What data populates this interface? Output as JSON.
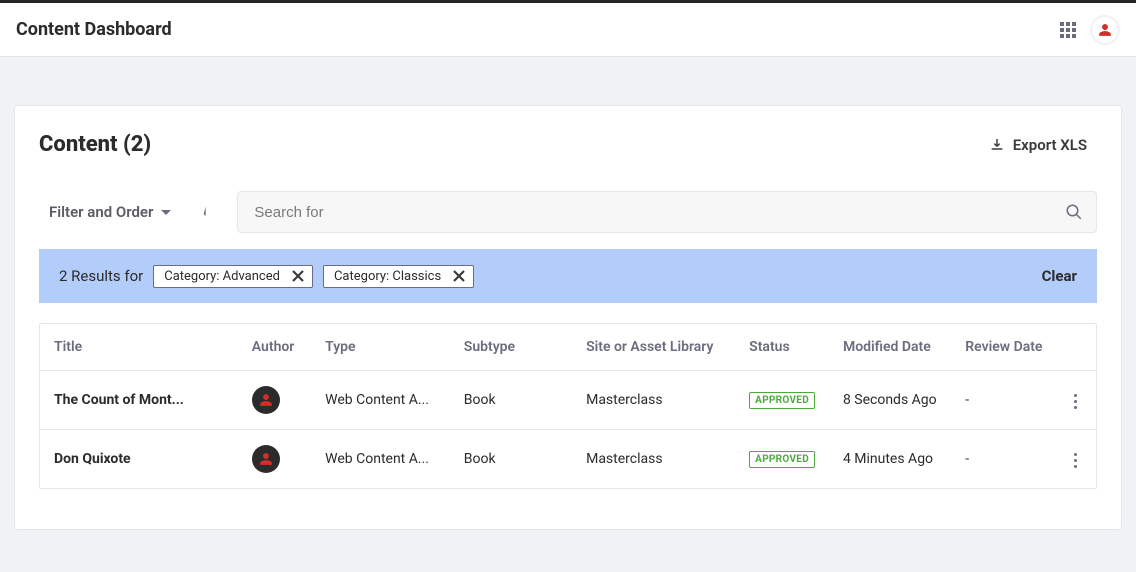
{
  "header": {
    "title": "Content Dashboard"
  },
  "content": {
    "title": "Content (2)",
    "export_label": "Export XLS"
  },
  "toolbar": {
    "filter_label": "Filter and Order",
    "search_placeholder": "Search for"
  },
  "filters": {
    "results_for": "2 Results for",
    "chips": [
      {
        "label": "Category: Advanced"
      },
      {
        "label": "Category: Classics"
      }
    ],
    "clear_label": "Clear"
  },
  "table": {
    "headers": {
      "title": "Title",
      "author": "Author",
      "type": "Type",
      "subtype": "Subtype",
      "site": "Site or Asset Library",
      "status": "Status",
      "modified": "Modified Date",
      "review": "Review Date"
    },
    "rows": [
      {
        "title": "The Count of Mont...",
        "type": "Web Content A...",
        "subtype": "Book",
        "site": "Masterclass",
        "status": "APPROVED",
        "modified": "8 Seconds Ago",
        "review": "-"
      },
      {
        "title": "Don Quixote",
        "type": "Web Content A...",
        "subtype": "Book",
        "site": "Masterclass",
        "status": "APPROVED",
        "modified": "4 Minutes Ago",
        "review": "-"
      }
    ]
  }
}
